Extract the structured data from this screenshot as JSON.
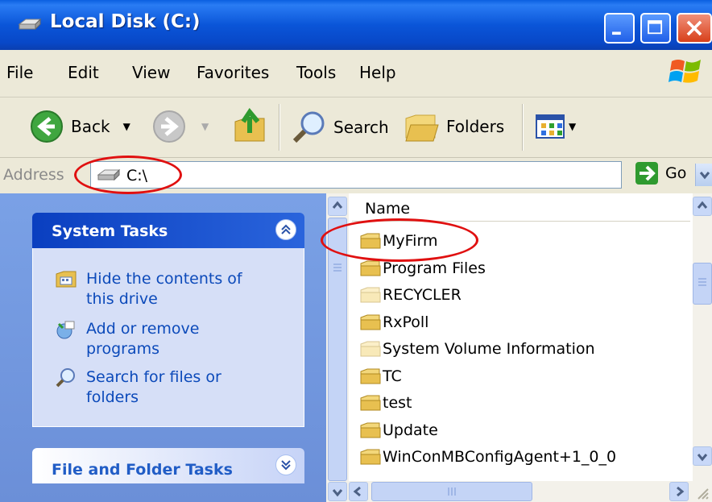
{
  "window": {
    "title": "Local Disk (C:)"
  },
  "menu": [
    "File",
    "Edit",
    "View",
    "Favorites",
    "Tools",
    "Help"
  ],
  "toolbar": {
    "back_label": "Back",
    "search_label": "Search",
    "folders_label": "Folders"
  },
  "address": {
    "label": "Address",
    "value": "C:\\",
    "go_label": "Go"
  },
  "system_tasks": {
    "title": "System Tasks",
    "items": [
      {
        "label": "Hide the contents of this drive",
        "icon": "hide-drive-icon"
      },
      {
        "label": "Add or remove programs",
        "icon": "add-remove-icon"
      },
      {
        "label": "Search for files or folders",
        "icon": "search-icon"
      }
    ]
  },
  "file_folder_tasks": {
    "title": "File and Folder Tasks"
  },
  "file_list": {
    "column_name": "Name",
    "items": [
      {
        "name": "MyFirm",
        "faded": false
      },
      {
        "name": "Program Files",
        "faded": false
      },
      {
        "name": "RECYCLER",
        "faded": true
      },
      {
        "name": "RxPoll",
        "faded": false
      },
      {
        "name": "System Volume Information",
        "faded": true
      },
      {
        "name": "TC",
        "faded": false
      },
      {
        "name": "test",
        "faded": false
      },
      {
        "name": "Update",
        "faded": false
      },
      {
        "name": "WinConMBConfigAgent+1_0_0",
        "faded": false
      }
    ]
  },
  "colors": {
    "title_blue": "#0a55d8",
    "task_link": "#0c4aba",
    "annotation_red": "#e01010"
  }
}
